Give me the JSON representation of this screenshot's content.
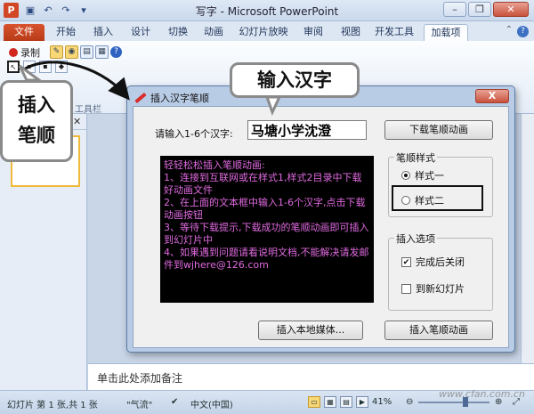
{
  "window": {
    "title": "写字 - Microsoft PowerPoint",
    "minimize": "–",
    "restore": "❐",
    "close": "✕"
  },
  "ribbon": {
    "tabs": [
      "文件",
      "开始",
      "插入",
      "设计",
      "切换",
      "动画",
      "幻灯片放映",
      "审阅",
      "视图",
      "开发工具",
      "加载项"
    ],
    "active_tab": "加载项",
    "record_label": "录制",
    "help": "?",
    "group_label": "工具栏"
  },
  "callouts": {
    "left": "插入\n笔顺",
    "top": "输入汉字"
  },
  "dialog": {
    "title": "插入汉字笔顺",
    "close": "X",
    "prompt": "请输入1-6个汉字:",
    "input_value": "马塘小学沈澄",
    "download_button": "下载笔顺动画",
    "info_text": "轻轻松松插入笔顺动画:\n1、连接到互联网或在样式1,样式2目录中下载好动画文件\n2、在上面的文本框中输入1-6个汉字,点击下载动画按钮\n3、等待下载提示,下载成功的笔顺动画即可插入到幻灯片中\n4、如果遇到问题请看说明文档,不能解决请发邮件到wjhere@126.com",
    "style_group": {
      "legend": "笔顺样式",
      "option1": "样式一",
      "option2": "样式二",
      "selected": "样式一"
    },
    "insert_group": {
      "legend": "插入选项",
      "close_after": "完成后关闭",
      "close_after_checked": true,
      "new_slide": "到新幻灯片",
      "new_slide_checked": false
    },
    "insert_local_button": "插入本地媒体...",
    "insert_button": "插入笔顺动画"
  },
  "notes": {
    "placeholder": "单击此处添加备注"
  },
  "status": {
    "slide_info": "幻灯片 第 1 张,共 1 张",
    "theme": "\"气流\"",
    "language": "中文(中国)",
    "zoom": "41%"
  },
  "watermark": "www.cfan.com.cn"
}
